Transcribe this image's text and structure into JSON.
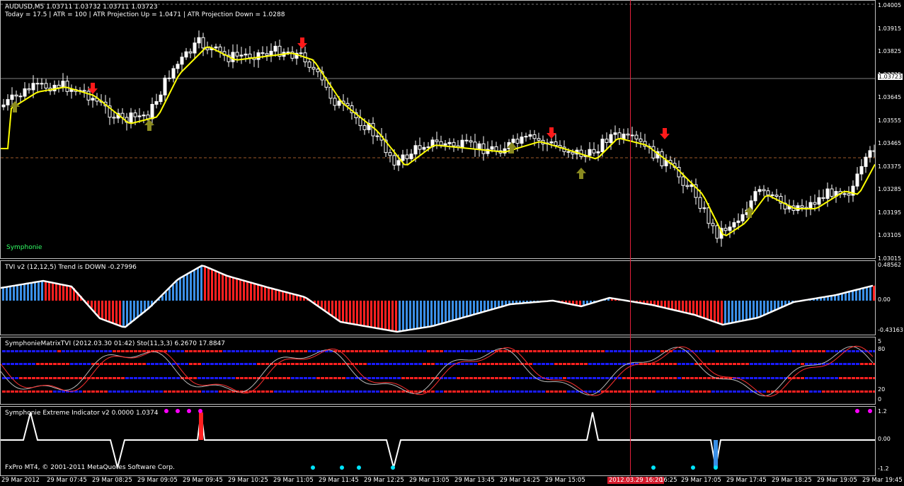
{
  "main": {
    "symbol_line": "AUDUSD,M5  1.03711 1.03732 1.03711 1.03723",
    "info_line": "Today = 17.5   |   ATR = 100   |   ATR Projection Up = 1.0471   |   ATR Projection Down = 1.0288",
    "indicator_name": "Symphonie",
    "price_ticks": [
      "1.04005",
      "1.03915",
      "1.03825",
      "1.03735",
      "1.03645",
      "1.03555",
      "1.03465",
      "1.03375",
      "1.03285",
      "1.03195",
      "1.03105",
      "1.03015"
    ],
    "current_price_tag": "1.03723",
    "colors": {
      "bull": "#ffffff",
      "bear": "#ffffff",
      "ma": "#ffff00",
      "up_arrow": "#8a8a20",
      "down_arrow": "#ff1a1a"
    }
  },
  "tvi": {
    "title": "TVI v2 (12,12,5) Trend is DOWN -0.27996",
    "ticks": [
      "0.48562",
      "0.00",
      "-0.43163"
    ],
    "colors": {
      "pos": "#3a8fe6",
      "neg": "#ff2020",
      "line": "#ffffff"
    }
  },
  "matrix": {
    "title": "SymphonieMatrixTVI (2012.03.30 01:42)  Sto(11,3,3) 6.2670 17.8847",
    "ticks": [
      "5",
      "80",
      "20",
      "0"
    ],
    "colors": {
      "blue": "#1a1aff",
      "red": "#ff2020"
    }
  },
  "extreme": {
    "title": "Symphonie Extreme Indicator v2 0.0000 1.0374",
    "ticks": [
      "1.2",
      "0.00",
      "-1.2"
    ],
    "copyright": "FxPro MT4, © 2001-2011 MetaQuotes Software Corp.",
    "colors": {
      "dot_top": "#ff00ff",
      "dot_bottom": "#00e5ff"
    }
  },
  "time_axis": {
    "labels": [
      "29 Mar 2012",
      "29 Mar 07:45",
      "29 Mar 08:25",
      "29 Mar 09:05",
      "29 Mar 09:45",
      "29 Mar 10:25",
      "29 Mar 11:05",
      "29 Mar 11:45",
      "29 Mar 12:25",
      "29 Mar 13:05",
      "29 Mar 13:45",
      "29 Mar 14:25",
      "29 Mar 15:05",
      "2012.03.29 16:20",
      "16:25",
      "29 Mar 17:05",
      "29 Mar 17:45",
      "29 Mar 18:25",
      "29 Mar 19:05",
      "29 Mar 19:45"
    ]
  }
}
